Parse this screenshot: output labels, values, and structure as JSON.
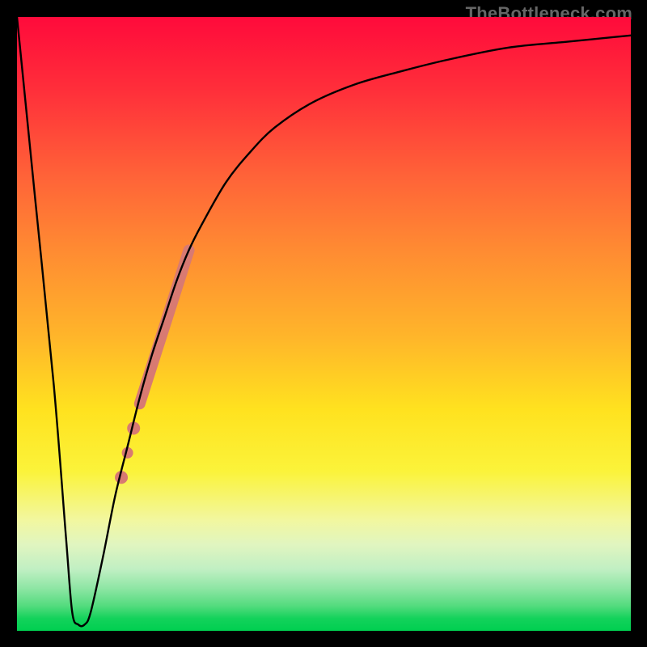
{
  "watermark": "TheBottleneck.com",
  "chart_data": {
    "type": "line",
    "title": "",
    "xlabel": "",
    "ylabel": "",
    "xlim": [
      0,
      100
    ],
    "ylim": [
      0,
      100
    ],
    "grid": false,
    "legend": false,
    "background_gradient": {
      "direction": "vertical",
      "stops": [
        {
          "pos": 0.0,
          "color": "#ff0a3b"
        },
        {
          "pos": 0.5,
          "color": "#ffd028"
        },
        {
          "pos": 0.82,
          "color": "#f2f7a0"
        },
        {
          "pos": 1.0,
          "color": "#00cf50"
        }
      ]
    },
    "series": [
      {
        "name": "bottleneck-curve",
        "x": [
          0,
          3,
          6,
          8,
          9,
          10,
          11,
          12,
          14,
          16,
          18,
          20,
          22,
          24,
          26,
          28,
          30,
          34,
          38,
          42,
          48,
          55,
          62,
          70,
          80,
          90,
          100
        ],
        "y": [
          100,
          70,
          40,
          15,
          3,
          1,
          1,
          3,
          12,
          22,
          30,
          38,
          45,
          51,
          57,
          62,
          66,
          73,
          78,
          82,
          86,
          89,
          91,
          93,
          95,
          96,
          97
        ],
        "color": "#000000"
      }
    ],
    "highlight": {
      "color": "#d87a72",
      "segment": {
        "x": [
          20,
          28
        ],
        "y": [
          37,
          62
        ]
      },
      "dots": [
        {
          "x": 19.0,
          "y": 33
        },
        {
          "x": 18.0,
          "y": 29
        },
        {
          "x": 17.0,
          "y": 25
        }
      ]
    },
    "notch": {
      "x_range": [
        9,
        11
      ],
      "y": 1
    }
  }
}
